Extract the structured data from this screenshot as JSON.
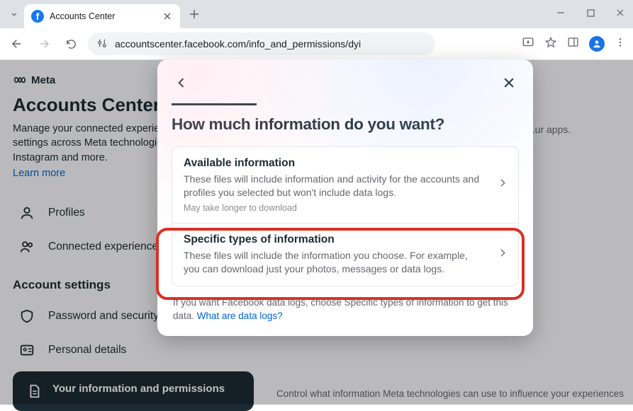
{
  "browser": {
    "tab_title": "Accounts Center",
    "url": "accountscenter.facebook.com/info_and_permissions/dyi"
  },
  "page": {
    "brand": "Meta",
    "title": "Accounts Center",
    "description": "Manage your connected experiences and account settings across Meta technologies like Facebook, Instagram and more.",
    "learn_more": "Learn more",
    "nav": {
      "profiles": "Profiles",
      "connected": "Connected experiences",
      "section": "Account settings",
      "password": "Password and security",
      "personal": "Personal details",
      "your_info": "Your information and permissions"
    },
    "right_hint": "...ur apps.",
    "bottom_hint": "Control what information Meta technologies can use to influence your experiences"
  },
  "modal": {
    "title": "How much information do you want?",
    "options": [
      {
        "title": "Available information",
        "desc": "These files will include information and activity for the accounts and profiles you selected but won't include data logs.",
        "note": "May take longer to download"
      },
      {
        "title": "Specific types of information",
        "desc": "These files will include the information you choose. For example, you can download just your photos, messages or data logs."
      }
    ],
    "footer_pre": "If you want Facebook data logs, choose Specific types of information to get this data. ",
    "footer_link": "What are data logs?"
  }
}
